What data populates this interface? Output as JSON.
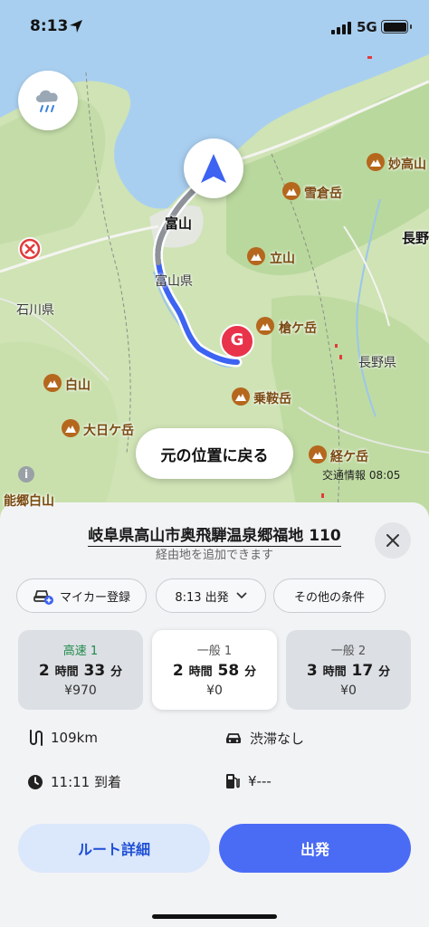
{
  "status_bar": {
    "time": "8:13",
    "network": "5G"
  },
  "map": {
    "return_button": "元の位置に戻る",
    "traffic_info": "交通情報 08:05",
    "info_icon_text": "i",
    "goal_marker": "G",
    "labels": {
      "toyama_city": "富山",
      "toyama_pref": "富山県",
      "ishikawa_pref": "石川県",
      "nagano_pref": "長野県",
      "nagano_city": "長野",
      "myoko": "妙高山",
      "yukikura": "雪倉岳",
      "tateyama": "立山",
      "yarigatake": "槍ケ岳",
      "hakusan": "白山",
      "norikura": "乗鞍岳",
      "dainichi": "大日ケ岳",
      "kyogatake": "経ケ岳",
      "nogo": "能郷白山"
    },
    "colors": {
      "route": "#3d63f2",
      "sea": "#a9cff0",
      "land": "#cfe3b5",
      "peak": "#b5671d",
      "goal": "#e8334a"
    }
  },
  "sheet": {
    "destination": "岐阜県高山市奥飛騨温泉郷福地 110",
    "subtitle": "経由地を追加できます",
    "chips": {
      "car": "マイカー登録",
      "departure": "8:13 出発",
      "conditions": "その他の条件"
    },
    "routes": [
      {
        "type": "高速 1",
        "hours": "2",
        "h_unit": "時間",
        "minutes": "33",
        "m_unit": "分",
        "fare": "¥970"
      },
      {
        "type": "一般 1",
        "hours": "2",
        "h_unit": "時間",
        "minutes": "58",
        "m_unit": "分",
        "fare": "¥0"
      },
      {
        "type": "一般 2",
        "hours": "3",
        "h_unit": "時間",
        "minutes": "17",
        "m_unit": "分",
        "fare": "¥0"
      }
    ],
    "info": {
      "distance": "109km",
      "traffic": "渋滞なし",
      "arrival": "11:11 到着",
      "toll": "¥---"
    },
    "buttons": {
      "detail": "ルート詳細",
      "start": "出発"
    }
  }
}
